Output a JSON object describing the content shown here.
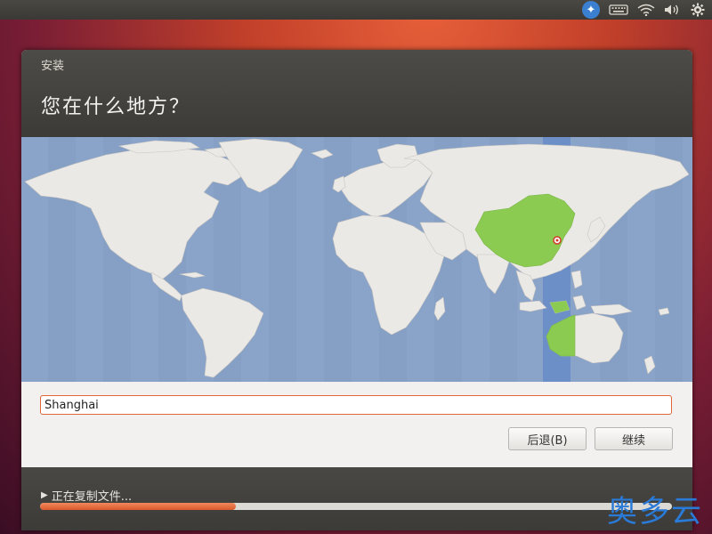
{
  "top_panel": {
    "icons": [
      "accessibility-icon",
      "keyboard-icon",
      "wifi-icon",
      "volume-icon",
      "settings-gear-icon"
    ]
  },
  "window": {
    "title": "安装",
    "page_title": "您在什么地方？"
  },
  "map": {
    "highlighted_region": "China",
    "selected_city": "Shanghai",
    "highlight_color": "#8ccb51",
    "timezone_band_color": "#6d8fc8",
    "ocean_color": "#8aa3c8",
    "land_color": "#ebe9e6"
  },
  "location_input": {
    "value": "Shanghai"
  },
  "buttons": {
    "back_label": "后退(B)",
    "continue_label": "继续"
  },
  "footer": {
    "status_arrow": "▶",
    "status_text": "正在复制文件...",
    "progress_fraction": 0.31,
    "progress_color": "#e0663a"
  },
  "watermark": {
    "text": "奥多云"
  }
}
